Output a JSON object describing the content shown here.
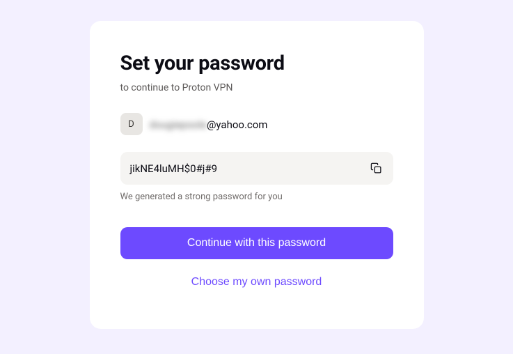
{
  "title": "Set your password",
  "subtitle": "to continue to Proton VPN",
  "account": {
    "avatar_letter": "D",
    "email_local": "dougiepoole",
    "email_domain": "@yahoo.com"
  },
  "password": {
    "value": "jikNE4luMH$0#j#9",
    "hint": "We generated a strong password for you"
  },
  "buttons": {
    "primary": "Continue with this password",
    "secondary": "Choose my own password"
  }
}
